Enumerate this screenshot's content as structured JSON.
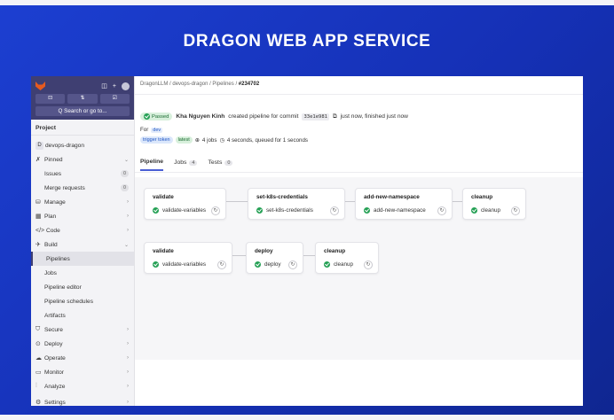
{
  "slide": {
    "title": "DRAGON WEB APP SERVICE"
  },
  "sidebar": {
    "search_label": "Q Search or go to...",
    "section_title": "Project",
    "project": {
      "initial": "D",
      "name": "devops-dragon"
    },
    "items": [
      {
        "label": "Pinned"
      },
      {
        "label": "Issues",
        "count": "0"
      },
      {
        "label": "Merge requests",
        "count": "0"
      },
      {
        "label": "Manage"
      },
      {
        "label": "Plan"
      },
      {
        "label": "Code"
      },
      {
        "label": "Build"
      },
      {
        "label": "Pipelines"
      },
      {
        "label": "Jobs"
      },
      {
        "label": "Pipeline editor"
      },
      {
        "label": "Pipeline schedules"
      },
      {
        "label": "Artifacts"
      },
      {
        "label": "Secure"
      },
      {
        "label": "Deploy"
      },
      {
        "label": "Operate"
      },
      {
        "label": "Monitor"
      },
      {
        "label": "Analyze"
      },
      {
        "label": "Settings"
      }
    ]
  },
  "breadcrumb": {
    "group": "DragonLLM",
    "project": "devops-dragon",
    "section": "Pipelines",
    "current": "#234702"
  },
  "pipeline": {
    "status": "Passed",
    "author": "Kha Nguyen Kinh",
    "action": "created pipeline for commit",
    "commit": "33e1e981",
    "timing": "just now, finished just now",
    "for_label": "For",
    "branch": "dev",
    "trigger": "trigger token",
    "latest": "latest",
    "jobs_text": "4 jobs",
    "duration_text": "4 seconds, queued for 1 seconds"
  },
  "tabs": [
    {
      "label": "Pipeline"
    },
    {
      "label": "Jobs",
      "count": "4"
    },
    {
      "label": "Tests",
      "count": "0"
    }
  ],
  "row1": [
    {
      "stage": "validate",
      "job": "validate-variables"
    },
    {
      "stage": "set-k8s-credentials",
      "job": "set-k8s-credentials"
    },
    {
      "stage": "add-new-namespace",
      "job": "add-new-namespace"
    },
    {
      "stage": "cleanup",
      "job": "cleanup"
    }
  ],
  "row2": [
    {
      "stage": "validate",
      "job": "validate-variables"
    },
    {
      "stage": "deploy",
      "job": "deploy"
    },
    {
      "stage": "cleanup",
      "job": "cleanup"
    }
  ],
  "colors": {
    "sidebar_dark": "#3f3f72",
    "success": "#26a156",
    "background_blue": "#1c3fd1"
  }
}
